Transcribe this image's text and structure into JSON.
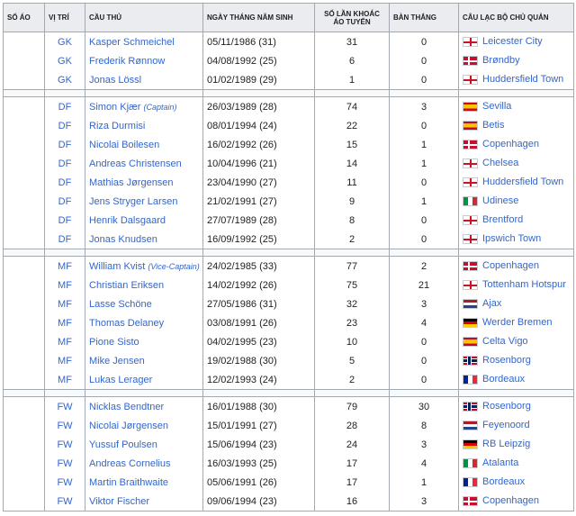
{
  "headers": {
    "number": "SỐ ÁO",
    "position": "VỊ TRÍ",
    "player": "CẦU THỦ",
    "dob": "NGÀY THÁNG NĂM SINH",
    "caps": "SỐ LẦN KHOÁC ÁO TUYỂN",
    "goals": "BÀN THẮNG",
    "club": "CÂU LẠC BỘ CHỦ QUẢN"
  },
  "groups": [
    [
      {
        "pos": "GK",
        "name": "Kasper Schmeichel",
        "note": "",
        "dob": "05/11/1986 (31)",
        "caps": "31",
        "goals": "0",
        "flag": "eng-flag",
        "club": "Leicester City"
      },
      {
        "pos": "GK",
        "name": "Frederik Rønnow",
        "note": "",
        "dob": "04/08/1992 (25)",
        "caps": "6",
        "goals": "0",
        "flag": "den-flag",
        "club": "Brøndby"
      },
      {
        "pos": "GK",
        "name": "Jonas Lössl",
        "note": "",
        "dob": "01/02/1989 (29)",
        "caps": "1",
        "goals": "0",
        "flag": "eng-flag",
        "club": "Huddersfield Town"
      }
    ],
    [
      {
        "pos": "DF",
        "name": "Simon Kjær",
        "note": "(Captain)",
        "dob": "26/03/1989 (28)",
        "caps": "74",
        "goals": "3",
        "flag": "esp-flag",
        "club": "Sevilla"
      },
      {
        "pos": "DF",
        "name": "Riza Durmisi",
        "note": "",
        "dob": "08/01/1994 (24)",
        "caps": "22",
        "goals": "0",
        "flag": "esp-flag",
        "club": "Betis"
      },
      {
        "pos": "DF",
        "name": "Nicolai Boilesen",
        "note": "",
        "dob": "16/02/1992 (26)",
        "caps": "15",
        "goals": "1",
        "flag": "den-flag",
        "club": "Copenhagen"
      },
      {
        "pos": "DF",
        "name": "Andreas Christensen",
        "note": "",
        "dob": "10/04/1996 (21)",
        "caps": "14",
        "goals": "1",
        "flag": "eng-flag",
        "club": "Chelsea"
      },
      {
        "pos": "DF",
        "name": "Mathias Jørgensen",
        "note": "",
        "dob": "23/04/1990 (27)",
        "caps": "11",
        "goals": "0",
        "flag": "eng-flag",
        "club": "Huddersfield Town"
      },
      {
        "pos": "DF",
        "name": "Jens Stryger Larsen",
        "note": "",
        "dob": "21/02/1991 (27)",
        "caps": "9",
        "goals": "1",
        "flag": "ita-flag",
        "club": "Udinese"
      },
      {
        "pos": "DF",
        "name": "Henrik Dalsgaard",
        "note": "",
        "dob": "27/07/1989 (28)",
        "caps": "8",
        "goals": "0",
        "flag": "eng-flag",
        "club": "Brentford"
      },
      {
        "pos": "DF",
        "name": "Jonas Knudsen",
        "note": "",
        "dob": "16/09/1992 (25)",
        "caps": "2",
        "goals": "0",
        "flag": "eng-flag",
        "club": "Ipswich Town"
      }
    ],
    [
      {
        "pos": "MF",
        "name": "William Kvist",
        "note": "(Vice-Captain)",
        "dob": "24/02/1985 (33)",
        "caps": "77",
        "goals": "2",
        "flag": "den-flag",
        "club": "Copenhagen"
      },
      {
        "pos": "MF",
        "name": "Christian Eriksen",
        "note": "",
        "dob": "14/02/1992 (26)",
        "caps": "75",
        "goals": "21",
        "flag": "eng-flag",
        "club": "Tottenham Hotspur"
      },
      {
        "pos": "MF",
        "name": "Lasse Schöne",
        "note": "",
        "dob": "27/05/1986 (31)",
        "caps": "32",
        "goals": "3",
        "flag": "ned-flag",
        "club": "Ajax"
      },
      {
        "pos": "MF",
        "name": "Thomas Delaney",
        "note": "",
        "dob": "03/08/1991 (26)",
        "caps": "23",
        "goals": "4",
        "flag": "ger-flag",
        "club": "Werder Bremen"
      },
      {
        "pos": "MF",
        "name": "Pione Sisto",
        "note": "",
        "dob": "04/02/1995 (23)",
        "caps": "10",
        "goals": "0",
        "flag": "esp-flag",
        "club": "Celta Vigo"
      },
      {
        "pos": "MF",
        "name": "Mike Jensen",
        "note": "",
        "dob": "19/02/1988 (30)",
        "caps": "5",
        "goals": "0",
        "flag": "nor-flag",
        "club": "Rosenborg"
      },
      {
        "pos": "MF",
        "name": "Lukas Lerager",
        "note": "",
        "dob": "12/02/1993 (24)",
        "caps": "2",
        "goals": "0",
        "flag": "fra-flag",
        "club": "Bordeaux"
      }
    ],
    [
      {
        "pos": "FW",
        "name": "Nicklas Bendtner",
        "note": "",
        "dob": "16/01/1988 (30)",
        "caps": "79",
        "goals": "30",
        "flag": "nor-flag",
        "club": "Rosenborg"
      },
      {
        "pos": "FW",
        "name": "Nicolai Jørgensen",
        "note": "",
        "dob": "15/01/1991 (27)",
        "caps": "28",
        "goals": "8",
        "flag": "ned-flag",
        "club": "Feyenoord"
      },
      {
        "pos": "FW",
        "name": "Yussuf Poulsen",
        "note": "",
        "dob": "15/06/1994 (23)",
        "caps": "24",
        "goals": "3",
        "flag": "ger-flag",
        "club": "RB Leipzig"
      },
      {
        "pos": "FW",
        "name": "Andreas Cornelius",
        "note": "",
        "dob": "16/03/1993 (25)",
        "caps": "17",
        "goals": "4",
        "flag": "ita-flag",
        "club": "Atalanta"
      },
      {
        "pos": "FW",
        "name": "Martin Braithwaite",
        "note": "",
        "dob": "05/06/1991 (26)",
        "caps": "17",
        "goals": "1",
        "flag": "fra-flag",
        "club": "Bordeaux"
      },
      {
        "pos": "FW",
        "name": "Viktor Fischer",
        "note": "",
        "dob": "09/06/1994 (23)",
        "caps": "16",
        "goals": "3",
        "flag": "den-flag",
        "club": "Copenhagen"
      }
    ]
  ]
}
